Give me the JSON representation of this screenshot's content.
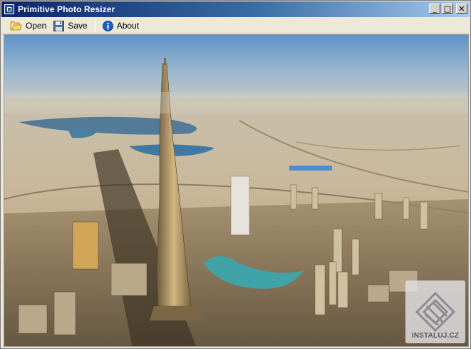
{
  "window": {
    "title": "Primitive Photo Resizer",
    "controls": {
      "minimize": "_",
      "maximize": "□",
      "close": "✕"
    }
  },
  "toolbar": {
    "items": [
      {
        "label": "Open",
        "icon": "folder-open-icon"
      },
      {
        "label": "Save",
        "icon": "floppy-disk-icon"
      },
      {
        "label": "About",
        "icon": "info-icon"
      }
    ]
  },
  "image": {
    "description_icon": "photo-canvas"
  },
  "watermark": {
    "text": "INSTALUJ.CZ"
  },
  "colors": {
    "titlebar_start": "#0a246a",
    "titlebar_end": "#a6caf0",
    "window_bg": "#ece9d8",
    "info_blue": "#1c5fc9",
    "folder_yellow": "#f1c64a"
  }
}
